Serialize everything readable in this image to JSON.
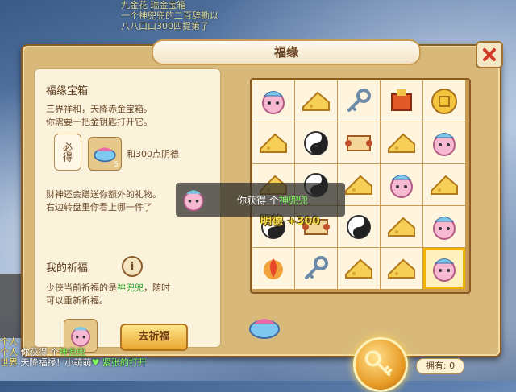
{
  "top_chat": {
    "line1": "九金花  瑞金宝箱",
    "line2": "一个神兜兜的二百辞勘以",
    "line3": "八八口口300四提第了"
  },
  "dialog": {
    "title": "福缘",
    "left": {
      "chest_title": "福缘宝箱",
      "chest_desc_1": "三界祥和，天降赤金宝箱。",
      "chest_desc_2": "你需要一把金钥匙打开它。",
      "must_label": "必得",
      "reward_text": "和300点阴德",
      "reward_qty": "5",
      "gift_line_1": "财神还会赠送你额外的礼物。",
      "gift_line_2": "右边转盘里你看上哪一件了",
      "wish_title": "我的祈福",
      "wish_info": "i",
      "wish_line_1_a": "少侠当前祈福的是",
      "wish_line_1_b": "神兜兜",
      "wish_line_1_c": "，随时",
      "wish_line_2": "可以重新祈福。",
      "pray_button": "去祈福"
    },
    "grid_items": [
      [
        "pig",
        "cheese",
        "key",
        "altar",
        "coin"
      ],
      [
        "cheese",
        "yinyang",
        "scroll",
        "cheese",
        "pig"
      ],
      [
        "cheese",
        "yinyang",
        "cheese",
        "pig",
        "cheese"
      ],
      [
        "yinyang",
        "scroll",
        "yinyang",
        "cheese",
        "pig"
      ],
      [
        "fire",
        "key",
        "cheese",
        "cheese",
        "pig"
      ]
    ],
    "selected_cell": [
      4,
      4
    ],
    "mingde_label": "明德 +300",
    "toast": {
      "text_a": "你获得 个",
      "text_b": "神兜兜"
    },
    "have_label": "拥有: 0"
  },
  "bottom_chat": [
    {
      "tag": "个人",
      "text": "",
      "hl": ""
    },
    {
      "tag": "个人",
      "text": "你获得 个",
      "hl": "神兜兜"
    },
    {
      "tag": "世界",
      "text": "天降福禄！小萌萌",
      "hl": "♥ 紧张的打开"
    }
  ],
  "colors": {
    "accent": "#f0b400",
    "highlight_green": "#7dff5a",
    "title_brown": "#6b4522"
  }
}
